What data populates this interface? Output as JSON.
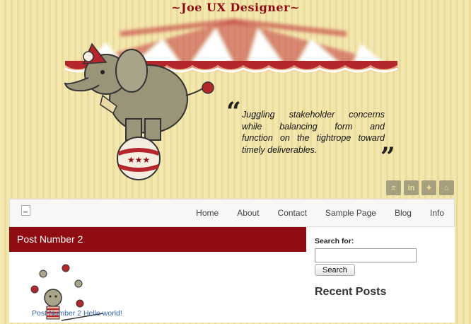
{
  "header": {
    "site_title": "~Joe UX Designer~",
    "tagline_lines": [
      "Juggling stakeholder concerns",
      "while balancing form and",
      "function on the tightrope toward",
      "timely deliverables."
    ],
    "quote_open": "“",
    "quote_close": "”"
  },
  "social": [
    {
      "name": "stackoverflow",
      "glyph": "≡"
    },
    {
      "name": "linkedin",
      "glyph": "in"
    },
    {
      "name": "twitter",
      "glyph": "✦"
    },
    {
      "name": "github",
      "glyph": "⌂"
    }
  ],
  "nav": {
    "items": [
      "Home",
      "About",
      "Contact",
      "Sample Page",
      "Blog",
      "Info"
    ]
  },
  "post": {
    "title": "Post Number 2"
  },
  "sidebar": {
    "search_label": "Search for:",
    "search_value": "",
    "search_button": "Search",
    "recent_title": "Recent Posts",
    "recent_links": [
      "Post Number 2 Hello world!"
    ]
  },
  "colors": {
    "accent": "#8e0c12",
    "background": "#f3e7b0",
    "link": "#3563a8"
  }
}
